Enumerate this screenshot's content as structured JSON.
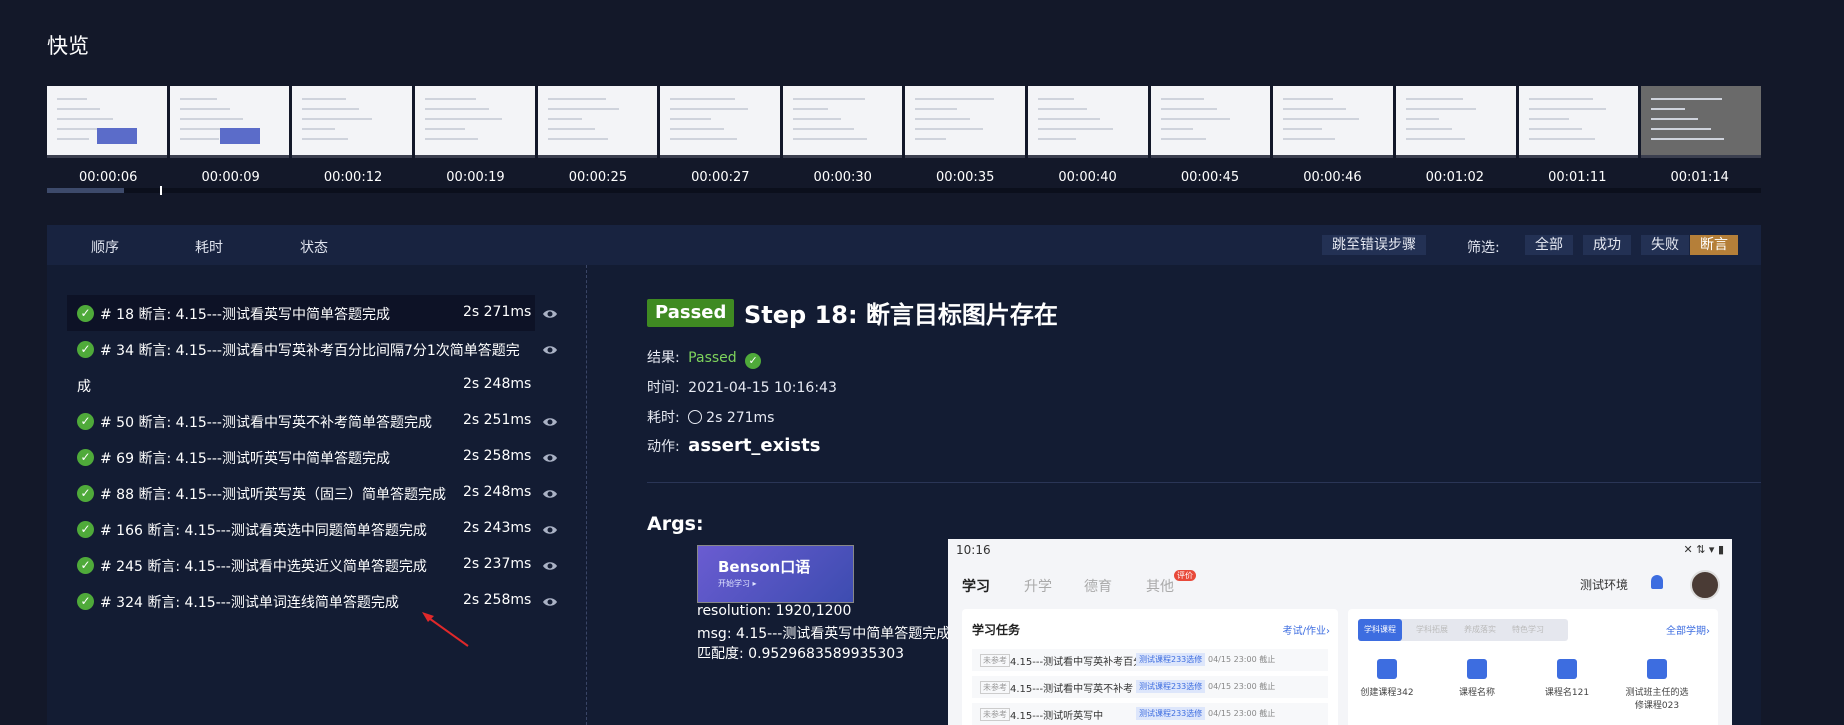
{
  "page": {
    "title": "快览"
  },
  "timeline": {
    "times": [
      "00:00:06",
      "00:00:09",
      "00:00:12",
      "00:00:19",
      "00:00:25",
      "00:00:27",
      "00:00:30",
      "00:00:35",
      "00:00:40",
      "00:00:45",
      "00:00:46",
      "00:01:02",
      "00:01:11",
      "00:01:14"
    ],
    "progress": 0.045
  },
  "toolbar": {
    "col_order": "顺序",
    "col_time": "耗时",
    "col_status": "状态",
    "jump_label": "跳至错误步骤",
    "filter_label": "筛选:",
    "filters": [
      "全部",
      "成功",
      "失败",
      "断言"
    ],
    "active_filter": "断言"
  },
  "steps": [
    {
      "text": "# 18 断言:  4.15---测试看英写中简单答题完成",
      "duration": "2s 271ms"
    },
    {
      "text": "# 34 断言:  4.15---测试看中写英补考百分比间隔7分1次简单答题完",
      "text2": "成",
      "duration": "2s 248ms"
    },
    {
      "text": "# 50 断言:  4.15---测试看中写英不补考简单答题完成",
      "duration": "2s 251ms"
    },
    {
      "text": "# 69 断言:  4.15---测试听英写中简单答题完成",
      "duration": "2s 258ms"
    },
    {
      "text": "# 88 断言:  4.15---测试听英写英（固三）简单答题完成",
      "duration": "2s 248ms"
    },
    {
      "text": "# 166 断言:  4.15---测试看英选中同题简单答题完成",
      "duration": "2s 243ms"
    },
    {
      "text": "# 245 断言:  4.15---测试看中选英近义简单答题完成",
      "duration": "2s 237ms"
    },
    {
      "text": "# 324 断言:  4.15---测试单词连线简单答题完成",
      "duration": "2s 258ms"
    }
  ],
  "detail": {
    "badge": "Passed",
    "title": "Step 18: 断言目标图片存在",
    "result_label": "结果:",
    "result_value": "Passed",
    "time_label": "时间:",
    "time_value": "2021-04-15 10:16:43",
    "duration_label": "耗时:",
    "duration_value": "2s 271ms",
    "action_label": "动作:",
    "action_value": "assert_exists",
    "args_title": "Args:",
    "thumb_title": "Benson口语",
    "thumb_sub": "开始学习 ▸",
    "resolution": "resolution: 1920,1200",
    "msg": "msg: 4.15---测试看英写中简单答题完成",
    "match": "匹配度:  0.9529683589935303"
  },
  "preview": {
    "time": "10:16",
    "tabs": [
      "学习",
      "升学",
      "德育",
      "其他"
    ],
    "badge": "评价",
    "env": "测试环境",
    "tasks_title": "学习任务",
    "tasks_link": "考试/作业›",
    "rows": [
      {
        "tag": "未参考",
        "text": "4.15---测试看中写英补考百分...",
        "chip": "测试课程233选修",
        "date": "04/15 23:00 截止"
      },
      {
        "tag": "未参考",
        "text": "4.15---测试看中写英不补考",
        "chip": "测试课程233选修",
        "date": "04/15 23:00 截止"
      },
      {
        "tag": "未参考",
        "text": "4.15---测试听英写中",
        "chip": "测试课程233选修",
        "date": "04/15 23:00 截止"
      }
    ],
    "course_tabs": [
      "学科课程",
      "学科拓展",
      "养成落实",
      "特色学习"
    ],
    "all_link": "全部学期›",
    "courses": [
      "创建课程342",
      "课程名称",
      "课程名121",
      "测试班主任的选修课程023"
    ]
  },
  "colors": {
    "accent": "#b57f39",
    "passed": "#3f8a22",
    "check": "#4faa3a",
    "background": "#131829"
  }
}
